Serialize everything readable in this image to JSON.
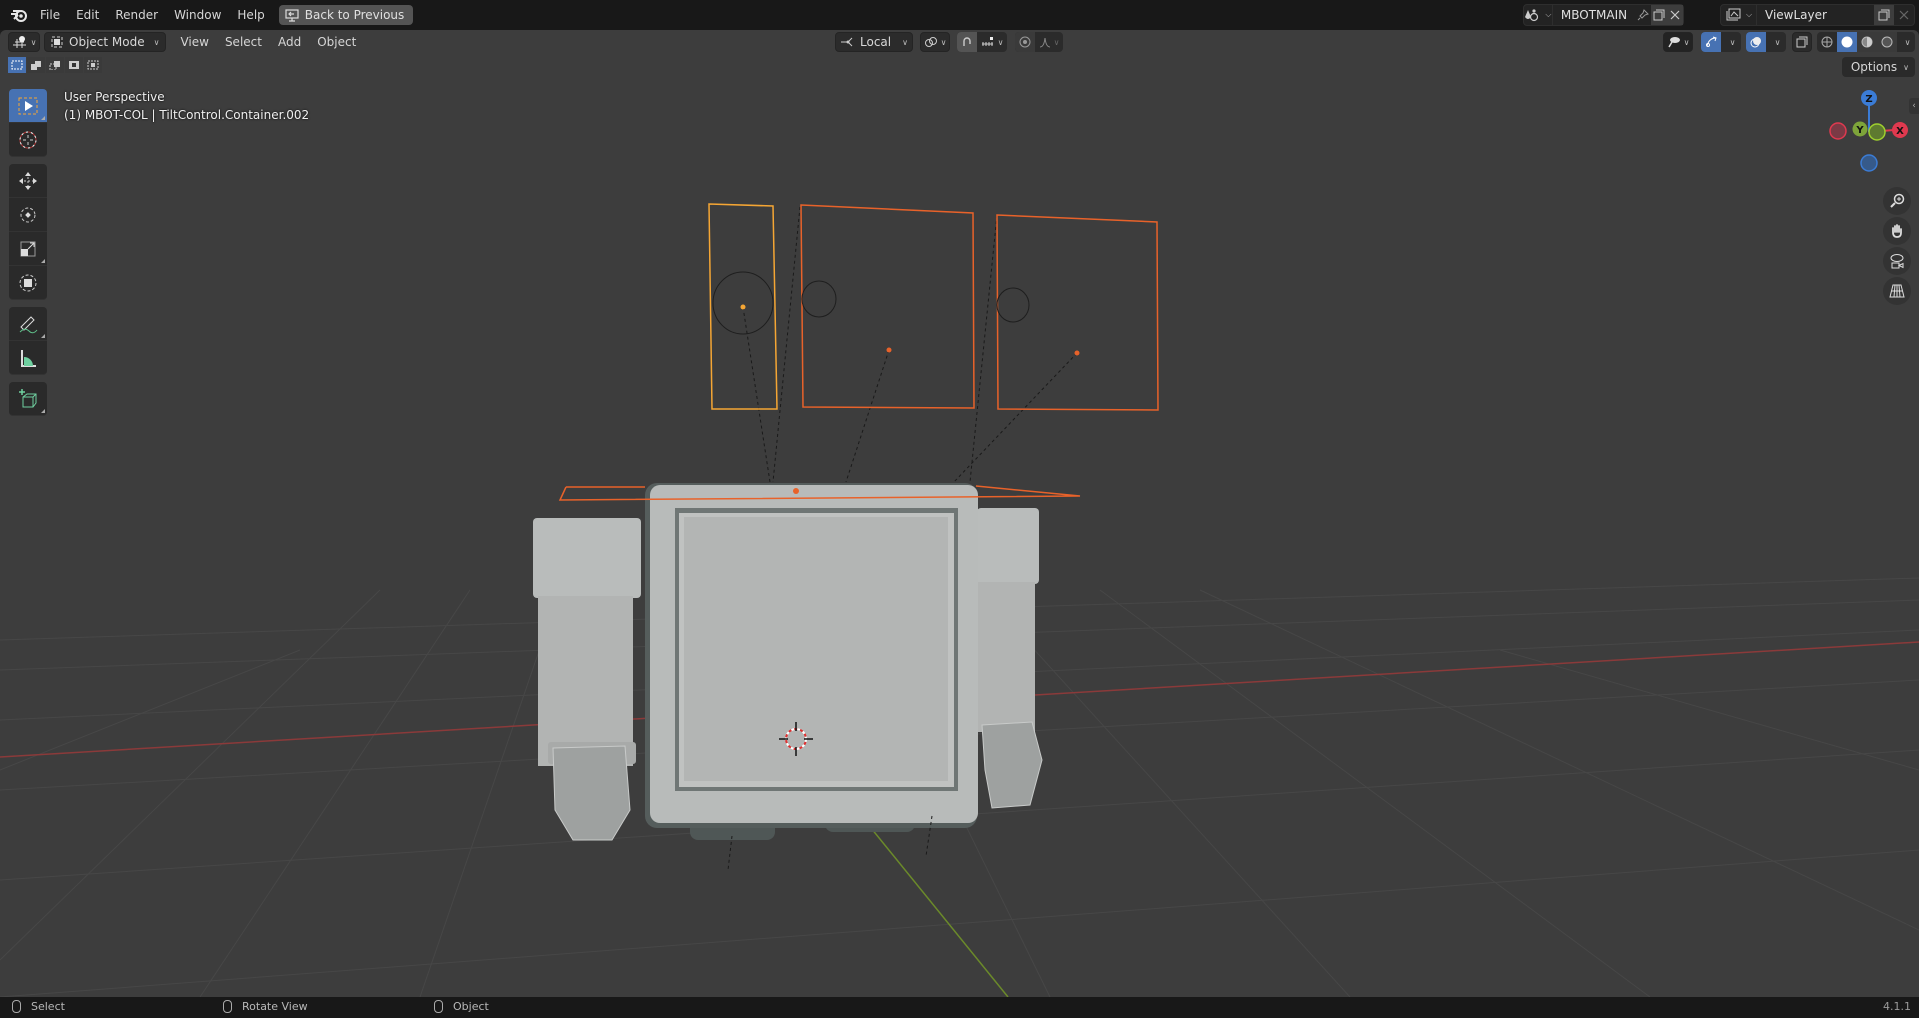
{
  "topbar": {
    "menus": [
      "File",
      "Edit",
      "Render",
      "Window",
      "Help"
    ],
    "back_button": "Back to Previous",
    "scene_name": "MBOTMAIN",
    "view_layer": "ViewLayer"
  },
  "header": {
    "editor_type_icon": "3d-viewport-icon",
    "mode": "Object Mode",
    "menus": [
      "View",
      "Select",
      "Add",
      "Object"
    ],
    "transform_orientation": "Local",
    "options_label": "Options",
    "shading_modes": [
      "wireframe",
      "solid",
      "material-preview",
      "rendered"
    ],
    "active_shading": "solid"
  },
  "selection_modes": [
    "set",
    "extend",
    "subtract",
    "invert",
    "intersect"
  ],
  "tools": [
    {
      "name": "select-box",
      "active": true
    },
    {
      "name": "cursor",
      "active": false
    },
    {
      "name": "move",
      "active": false
    },
    {
      "name": "rotate",
      "active": false
    },
    {
      "name": "scale",
      "active": false
    },
    {
      "name": "transform",
      "active": false
    },
    {
      "name": "annotate",
      "active": false
    },
    {
      "name": "measure",
      "active": false
    },
    {
      "name": "add-cube",
      "active": false
    }
  ],
  "viewport": {
    "view_name": "User Perspective",
    "object_info": "(1) MBOT-COL | TiltControl.Container.002"
  },
  "gizmo": {
    "axes": [
      "Z",
      "Y",
      "X"
    ],
    "colors": {
      "x": "#e0394f",
      "y": "#7ea43a",
      "z": "#3b7cd6"
    }
  },
  "nav_buttons": [
    "zoom",
    "pan",
    "camera",
    "perspective-ortho"
  ],
  "statusbar": {
    "left_click": "Select",
    "middle_click": "Rotate View",
    "right_click": "Object",
    "version": "4.1.1"
  },
  "colors": {
    "accent": "#4772b3",
    "selection_orange": "#e8622a",
    "active_orange": "#f5a634",
    "viewport_bg": "#3d3d3d"
  }
}
